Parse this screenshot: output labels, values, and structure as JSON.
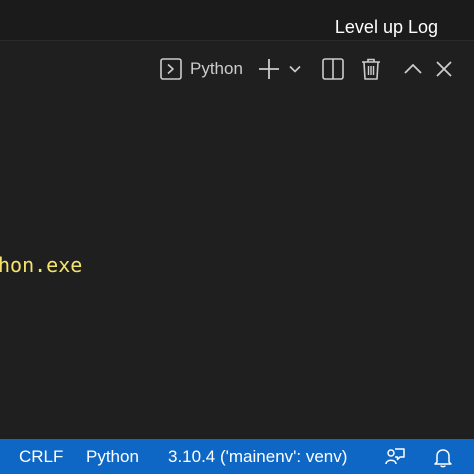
{
  "colors": {
    "background": "#1f1f1f",
    "statusbar": "#0e67c4",
    "terminal_text": "#f5e36c",
    "foreground": "#cccccc"
  },
  "header": {
    "title": "Level up Log"
  },
  "terminal_toolbar": {
    "terminal_icon": "terminal-icon",
    "terminal_name": "Python",
    "new_terminal_icon": "plus-icon",
    "dropdown_icon": "chevron-down-icon",
    "split_icon": "split-editor-icon",
    "kill_icon": "trash-icon",
    "maximize_icon": "chevron-up-icon",
    "close_icon": "close-icon"
  },
  "terminal": {
    "visible_line": "hon.exe"
  },
  "statusbar": {
    "line_ending": "CRLF",
    "language": "Python",
    "interpreter": "3.10.4 ('mainenv': venv)",
    "feedback_icon": "feedback-icon",
    "notifications_icon": "bell-icon"
  }
}
